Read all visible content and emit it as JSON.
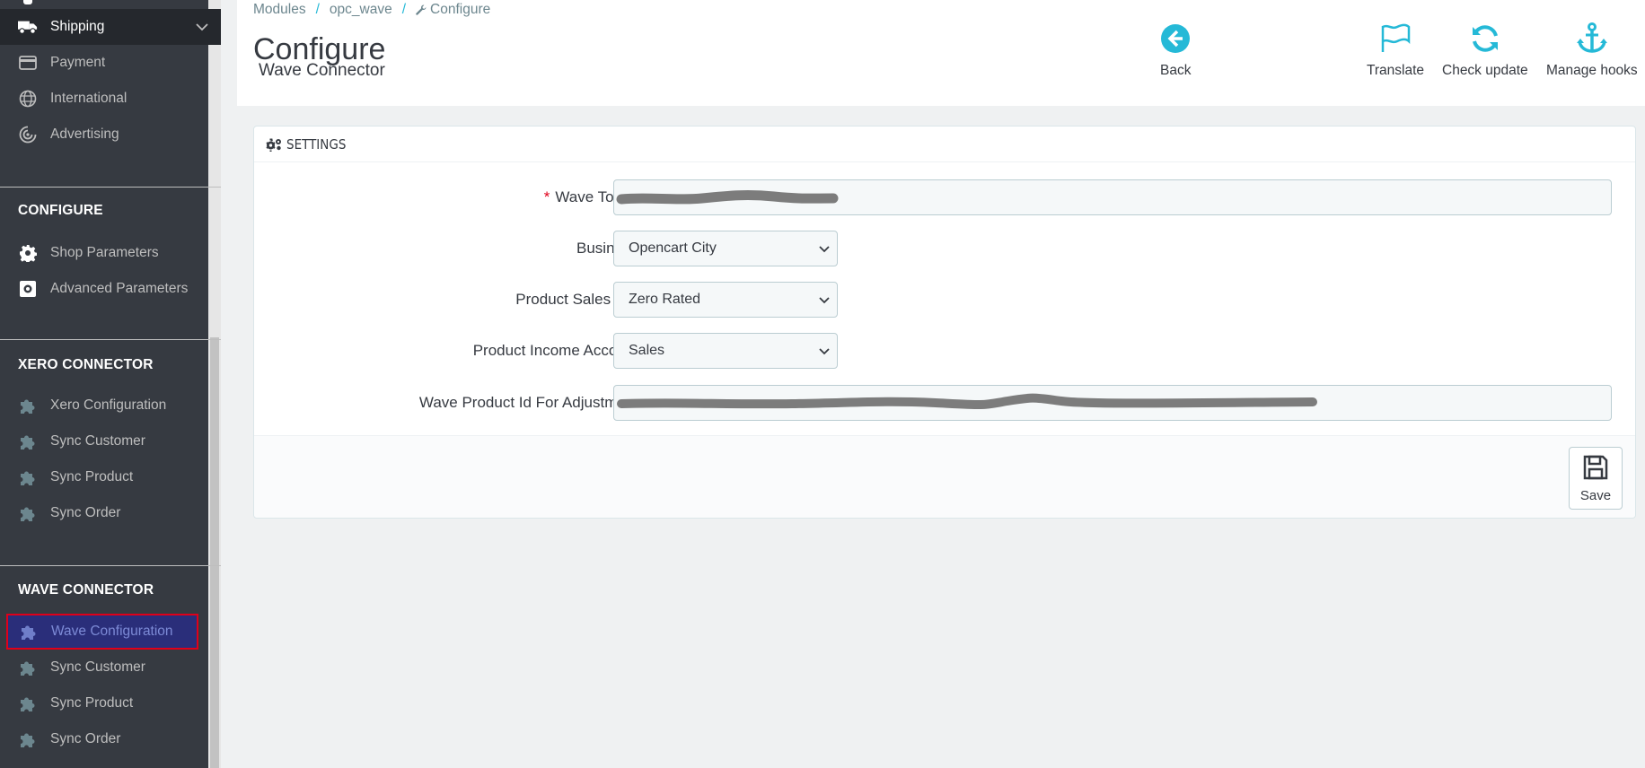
{
  "sidebar": {
    "items_top": [
      {
        "label": "Shipping",
        "icon": "truck-icon"
      },
      {
        "label": "Payment",
        "icon": "credit-card-icon"
      },
      {
        "label": "International",
        "icon": "globe-icon"
      },
      {
        "label": "Advertising",
        "icon": "target-icon"
      }
    ],
    "configure_title": "CONFIGURE",
    "configure_items": [
      {
        "label": "Shop Parameters",
        "icon": "gear-icon"
      },
      {
        "label": "Advanced Parameters",
        "icon": "settings-box-icon"
      }
    ],
    "xero_title": "XERO CONNECTOR",
    "xero_items": [
      {
        "label": "Xero Configuration",
        "icon": "puzzle-icon"
      },
      {
        "label": "Sync Customer",
        "icon": "puzzle-icon"
      },
      {
        "label": "Sync Product",
        "icon": "puzzle-icon"
      },
      {
        "label": "Sync Order",
        "icon": "puzzle-icon"
      }
    ],
    "wave_title": "WAVE CONNECTOR",
    "wave_items": [
      {
        "label": "Wave Configuration",
        "icon": "puzzle-icon"
      },
      {
        "label": "Sync Customer",
        "icon": "puzzle-icon"
      },
      {
        "label": "Sync Product",
        "icon": "puzzle-icon"
      },
      {
        "label": "Sync Order",
        "icon": "puzzle-icon"
      }
    ]
  },
  "header": {
    "breadcrumb": [
      "Modules",
      "opc_wave",
      "Configure"
    ],
    "title": "Configure",
    "subtitle": "Wave Connector",
    "toolbar": {
      "back": "Back",
      "translate": "Translate",
      "check_update": "Check update",
      "manage_hooks": "Manage hooks"
    }
  },
  "settings": {
    "panel_title": "SETTINGS",
    "fields": {
      "wave_token_label": "Wave Token",
      "business_label": "Business",
      "business_value": "Opencart City",
      "sales_tax_label": "Product Sales Tax",
      "sales_tax_value": "Zero Rated",
      "income_account_label": "Product Income Account",
      "income_account_value": "Sales",
      "product_id_label": "Wave Product Id For Adjustment"
    },
    "save_label": "Save"
  },
  "colors": {
    "accent": "#25b9d7",
    "sidebar_bg": "#363a41",
    "selected_bg": "#2a2e7a",
    "highlight_border": "#e0001a"
  }
}
